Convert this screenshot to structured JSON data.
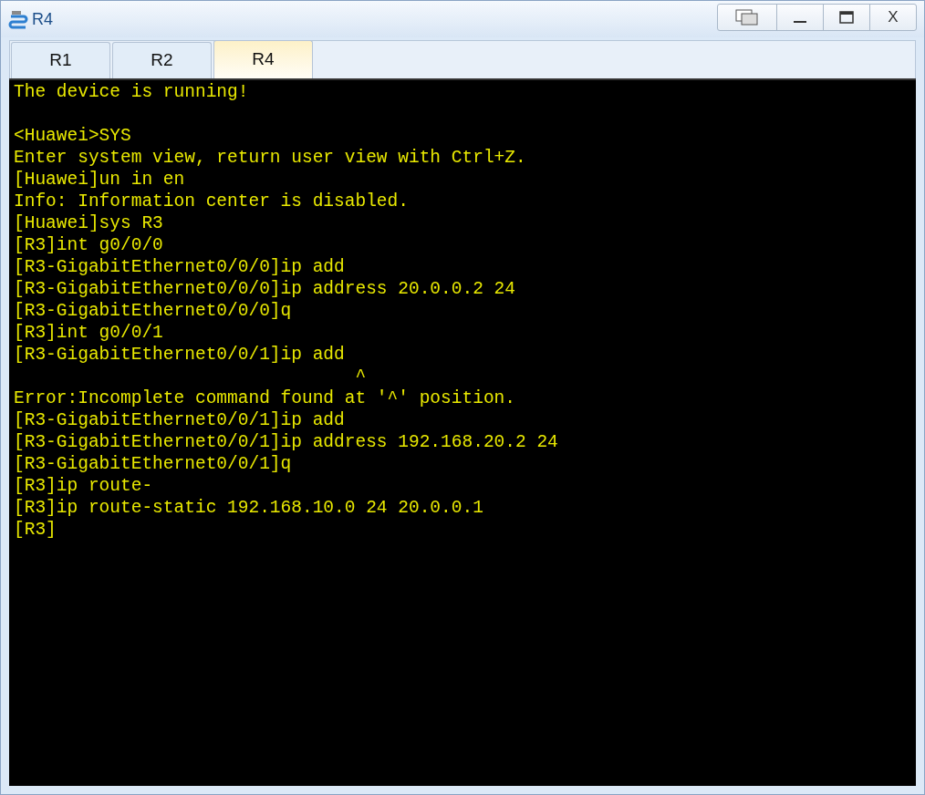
{
  "window": {
    "title": "R4"
  },
  "tabs": [
    {
      "label": "R1",
      "selected": false
    },
    {
      "label": "R2",
      "selected": false
    },
    {
      "label": "R4",
      "selected": true
    }
  ],
  "window_buttons": [
    {
      "kind": "restore"
    },
    {
      "kind": "minimize"
    },
    {
      "kind": "maximize"
    },
    {
      "kind": "close",
      "label": "X"
    }
  ],
  "terminal": {
    "lines": [
      {
        "kind": "text",
        "text": "The device is running!"
      },
      {
        "kind": "blank"
      },
      {
        "kind": "text",
        "text": "<Huawei>SYS"
      },
      {
        "kind": "text",
        "text": "Enter system view, return user view with Ctrl+Z."
      },
      {
        "kind": "text",
        "text": "[Huawei]un in en"
      },
      {
        "kind": "text",
        "text": "Info: Information center is disabled."
      },
      {
        "kind": "text",
        "text": "[Huawei]sys R3"
      },
      {
        "kind": "text",
        "text": "[R3]int g0/0/0"
      },
      {
        "kind": "text",
        "text": "[R3-GigabitEthernet0/0/0]ip add"
      },
      {
        "kind": "text",
        "text": "[R3-GigabitEthernet0/0/0]ip address 20.0.0.2 24"
      },
      {
        "kind": "text",
        "text": "[R3-GigabitEthernet0/0/0]q"
      },
      {
        "kind": "text",
        "text": "[R3]int g0/0/1"
      },
      {
        "kind": "text",
        "text": "[R3-GigabitEthernet0/0/1]ip add"
      },
      {
        "kind": "text",
        "text": "                                ^"
      },
      {
        "kind": "text",
        "text": "Error:Incomplete command found at '^' position."
      },
      {
        "kind": "text",
        "text": "[R3-GigabitEthernet0/0/1]ip add"
      },
      {
        "kind": "text",
        "text": "[R3-GigabitEthernet0/0/1]ip address 192.168.20.2 24"
      },
      {
        "kind": "text",
        "text": "[R3-GigabitEthernet0/0/1]q"
      },
      {
        "kind": "text",
        "text": "[R3]ip route-"
      },
      {
        "kind": "text",
        "text": "[R3]ip route-static 192.168.10.0 24 20.0.0.1"
      },
      {
        "kind": "text",
        "text": "[R3]"
      }
    ]
  }
}
